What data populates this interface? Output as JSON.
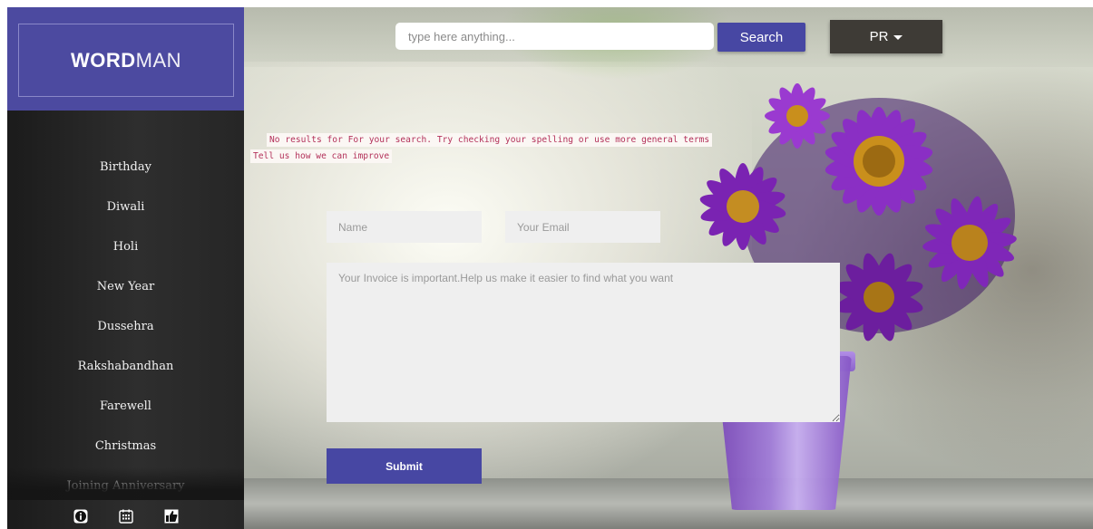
{
  "brand": {
    "bold_part": "WORD",
    "light_part": "MAN"
  },
  "sidebar": {
    "items": [
      {
        "label": "Birthday"
      },
      {
        "label": "Diwali"
      },
      {
        "label": "Holi"
      },
      {
        "label": "New Year"
      },
      {
        "label": "Dussehra"
      },
      {
        "label": "Rakshabandhan"
      },
      {
        "label": "Farewell"
      },
      {
        "label": "Christmas"
      },
      {
        "label": "Joining Anniversary"
      }
    ],
    "footer_icons": [
      "info-icon",
      "calendar-icon",
      "thumbs-up-icon"
    ]
  },
  "header": {
    "search_placeholder": "type here anything...",
    "search_button": "Search",
    "language": "PR"
  },
  "messages": {
    "no_results": "No results for For your search. Try checking your spelling or use more general terms",
    "feedback_prompt": "Tell us how we can improve"
  },
  "form": {
    "name_placeholder": "Name",
    "email_placeholder": "Your Email",
    "message_placeholder": "Your Invoice is important.Help us make it easier to find what you want",
    "submit_label": "Submit"
  },
  "colors": {
    "accent": "#4747a3",
    "logo_bg": "#4c4aa0",
    "sidebar_bg": "#262626",
    "message_text": "#b3315a"
  }
}
